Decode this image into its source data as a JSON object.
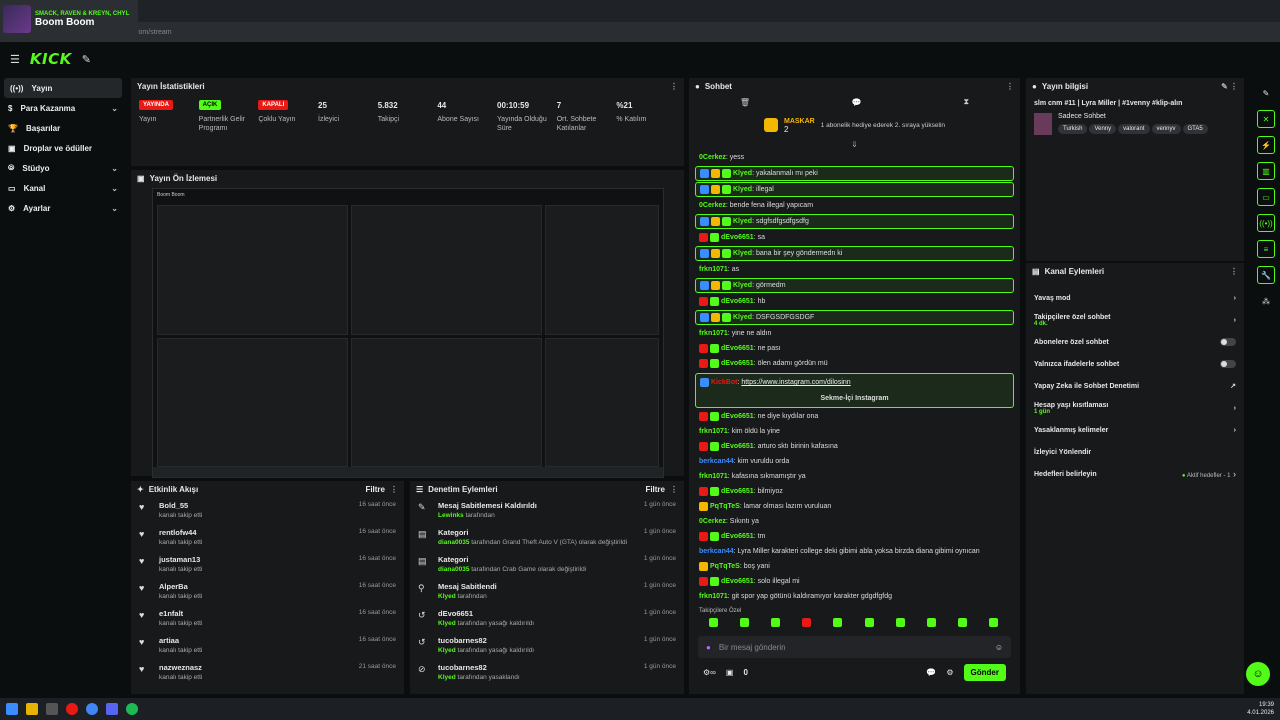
{
  "media": {
    "artists": "SMACK, RAVEN & KREYN, CHYL",
    "title": "Boom Boom"
  },
  "browser": {
    "url": "dashboard.kick.com/stream"
  },
  "kick": {
    "logo": "KICK"
  },
  "sidebar": {
    "items": [
      {
        "label": "Yayın",
        "chev": "",
        "active": true
      },
      {
        "label": "Para Kazanma",
        "chev": "⌄"
      },
      {
        "label": "Başarılar",
        "chev": ""
      },
      {
        "label": "Droplar ve ödüller",
        "chev": ""
      },
      {
        "label": "Stüdyo",
        "chev": "⌄"
      },
      {
        "label": "Kanal",
        "chev": "⌄"
      },
      {
        "label": "Ayarlar",
        "chev": "⌄"
      }
    ]
  },
  "stats": {
    "title": "Yayın İstatistikleri",
    "items": [
      {
        "value": "YAYINDA",
        "label": "Yayın",
        "badge": "red"
      },
      {
        "value": "AÇIK",
        "label": "Partnerlik Gelir Programı",
        "badge": "green"
      },
      {
        "value": "KAPALI",
        "label": "Çoklu Yayın",
        "badge": "red"
      },
      {
        "value": "25",
        "label": "İzleyici"
      },
      {
        "value": "5.832",
        "label": "Takipçi"
      },
      {
        "value": "44",
        "label": "Abone Sayısı"
      },
      {
        "value": "00:10:59",
        "label": "Yayında Olduğu Süre"
      },
      {
        "value": "7",
        "label": "Ort. Sohbete Katılanlar"
      },
      {
        "value": "%21",
        "label": "% Katılım"
      }
    ]
  },
  "preview": {
    "title": "Yayın Ön İzlemesi",
    "inner_title": "Boom Boom"
  },
  "activity": {
    "title": "Etkinlik Akışı",
    "filter": "Filtre",
    "items": [
      {
        "name": "Bold_55",
        "sub": "kanalı takip etti",
        "time": "16 saat önce"
      },
      {
        "name": "rentlofw44",
        "sub": "kanalı takip etti",
        "time": "16 saat önce"
      },
      {
        "name": "justaman13",
        "sub": "kanalı takip etti",
        "time": "16 saat önce"
      },
      {
        "name": "AlperBa",
        "sub": "kanalı takip etti",
        "time": "16 saat önce"
      },
      {
        "name": "e1nfalt",
        "sub": "kanalı takip etti",
        "time": "16 saat önce"
      },
      {
        "name": "artiaa",
        "sub": "kanalı takip etti",
        "time": "16 saat önce"
      },
      {
        "name": "nazwezna​sz",
        "sub": "kanalı takip etti",
        "time": "21 saat önce"
      }
    ]
  },
  "mod": {
    "title": "Denetim Eylemleri",
    "filter": "Filtre",
    "items": [
      {
        "icon": "✎",
        "name": "Mesaj Sabitlemesi Kaldırıldı",
        "user": "Lewinks",
        "sub": " tarafından",
        "time": "1 gün önce"
      },
      {
        "icon": "▤",
        "name": "Kategori",
        "user": "diana0035",
        "sub": " tarafından Grand Theft Auto V (GTA) olarak değiştirildi",
        "time": "1 gün önce"
      },
      {
        "icon": "▤",
        "name": "Kategori",
        "user": "diana0035",
        "sub": " tarafından Crab Game olarak değiştirildi",
        "time": "1 gün önce"
      },
      {
        "icon": "⚲",
        "name": "Mesaj Sabitlendi",
        "user": "Klyed",
        "sub": " tarafından",
        "time": "1 gün önce"
      },
      {
        "icon": "↺",
        "name": "dEvo6651",
        "user": "Klyed",
        "sub": " tarafından yasağı kaldırıldı",
        "time": "1 gün önce"
      },
      {
        "icon": "↺",
        "name": "tucobarnes82",
        "user": "Klyed",
        "sub": " tarafından yasağı kaldırıldı",
        "time": "1 gün önce"
      },
      {
        "icon": "⊘",
        "name": "tucobarnes82",
        "user": "Klyed",
        "sub": " tarafından yasaklandı",
        "time": "1 gün önce"
      }
    ]
  },
  "chat": {
    "title": "Sohbet",
    "pinned_user": "MASKAR",
    "pinned_count": "2",
    "pinned_text": "1 abonelik hediye ederek 2. sıraya yükselin",
    "messages": [
      {
        "user": "0Cerkez",
        "color": "#53fc18",
        "text": "yess",
        "hl": false,
        "badges": 0
      },
      {
        "user": "Klyed",
        "color": "#53fc18",
        "text": "yakalanmalı mı peki",
        "hl": true,
        "badges": 3
      },
      {
        "user": "Klyed",
        "color": "#53fc18",
        "text": "illegal",
        "hl": true,
        "badges": 3
      },
      {
        "user": "0Cerkez",
        "color": "#53fc18",
        "text": "bende fena illegal yapıcam",
        "hl": false,
        "badges": 0
      },
      {
        "user": "Klyed",
        "color": "#53fc18",
        "text": "sdgfsdfgsdfgsdfg",
        "hl": true,
        "badges": 3
      },
      {
        "user": "dEvo6651",
        "color": "#53fc18",
        "text": "sa",
        "hl": false,
        "badges": 2
      },
      {
        "user": "Klyed",
        "color": "#53fc18",
        "text": "bana bir şey göndermedn ki",
        "hl": true,
        "badges": 3
      },
      {
        "user": "frkn1071",
        "color": "#53fc18",
        "text": "as",
        "hl": false,
        "badges": 0
      },
      {
        "user": "Klyed",
        "color": "#53fc18",
        "text": "görmedm",
        "hl": true,
        "badges": 3
      },
      {
        "user": "dEvo6651",
        "color": "#53fc18",
        "text": "hb",
        "hl": false,
        "badges": 2
      },
      {
        "user": "Klyed",
        "color": "#53fc18",
        "text": "DSFGSDFGSDGF",
        "hl": true,
        "badges": 3
      },
      {
        "user": "frkn1071",
        "color": "#53fc18",
        "text": "yine ne aldın",
        "hl": false,
        "badges": 0
      },
      {
        "user": "dEvo6651",
        "color": "#53fc18",
        "text": "ne pası",
        "hl": false,
        "badges": 2
      },
      {
        "user": "dEvo6651",
        "color": "#53fc18",
        "text": "ölen adamı gördün mü",
        "hl": false,
        "badges": 2
      }
    ],
    "link_user": "KickBot",
    "link_text": "https://www.instagram.com/dilosinn",
    "link_button": "Sekme-İçi Instagram",
    "messages2": [
      {
        "user": "dEvo6651",
        "color": "#53fc18",
        "text": "ne diye kıydılar ona",
        "badges": 2
      },
      {
        "user": "frkn1071",
        "color": "#53fc18",
        "text": "kim öldü la yine",
        "badges": 0
      },
      {
        "user": "dEvo6651",
        "color": "#53fc18",
        "text": "arturo sktı birinin kafasına",
        "badges": 2
      },
      {
        "user": "berkcan44",
        "color": "#3a8dff",
        "text": "kim vuruldu orda",
        "badges": 0
      },
      {
        "user": "frkn1071",
        "color": "#53fc18",
        "text": "kafasına sıkmamıştır ya",
        "badges": 0
      },
      {
        "user": "dEvo6651",
        "color": "#53fc18",
        "text": "bilmiyoz",
        "badges": 2
      },
      {
        "user": "PqTqTeS",
        "color": "#53fc18",
        "text": "lamar olması lazım vuruluan",
        "badges": 1
      },
      {
        "user": "0Cerkez",
        "color": "#53fc18",
        "text": "Sıkıntı ya",
        "badges": 0
      },
      {
        "user": "dEvo6651",
        "color": "#53fc18",
        "text": "tm",
        "badges": 2
      },
      {
        "user": "berkcan44",
        "color": "#3a8dff",
        "text": "Lyra Miller karakteri college deki gibimi abla yoksa birzda diana gibimi oynıcan",
        "badges": 0
      },
      {
        "user": "PqTqTeS",
        "color": "#53fc18",
        "text": "boş yani",
        "badges": 1
      },
      {
        "user": "dEvo6651",
        "color": "#53fc18",
        "text": "solo illegal mi",
        "badges": 2
      },
      {
        "user": "frkn1071",
        "color": "#53fc18",
        "text": "git spor yap götünü kaldıramıyor karakter gdgdfgfdg",
        "badges": 0
      }
    ],
    "followers_only": "Takipçilere Özel",
    "placeholder": "Bir mesaj gönderin",
    "count": "0",
    "send": "Gönder"
  },
  "stream_info": {
    "title": "Yayın bilgisi",
    "stream_title": "slm cnm #11 | Lyra Miller | #1venny #klip-alın",
    "category": "Sadece Sohbet",
    "tags": [
      "Turkish",
      "Venny",
      "valorant",
      "vennyv",
      "GTA5"
    ]
  },
  "channel_actions": {
    "title": "Kanal Eylemleri",
    "items": [
      {
        "label": "Yavaş mod",
        "sub": "",
        "control": "chev"
      },
      {
        "label": "Takipçilere özel sohbet",
        "sub": "4 dk.",
        "control": "chev"
      },
      {
        "label": "Abonelere özel sohbet",
        "sub": "",
        "control": "toggle"
      },
      {
        "label": "Yalnızca ifadelerle sohbet",
        "sub": "",
        "control": "toggle"
      },
      {
        "label": "Yapay Zeka ile Sohbet Denetimi",
        "sub": "",
        "control": "ext"
      },
      {
        "label": "Hesap yaşı kısıtlaması",
        "sub": "1 gün",
        "control": "chev"
      },
      {
        "label": "Yasaklanmış kelimeler",
        "sub": "",
        "control": "chev"
      },
      {
        "label": "İzleyici Yönlendir",
        "sub": "",
        "control": ""
      },
      {
        "label": "Hedefleri belirleyin",
        "sub": "",
        "control": "goal",
        "extra": "Aktif hedefler - 1"
      }
    ]
  },
  "taskbar": {
    "time": "19:39",
    "date": "4.01.2026"
  },
  "colors": {
    "accent": "#53fc18",
    "live": "#e91916"
  }
}
